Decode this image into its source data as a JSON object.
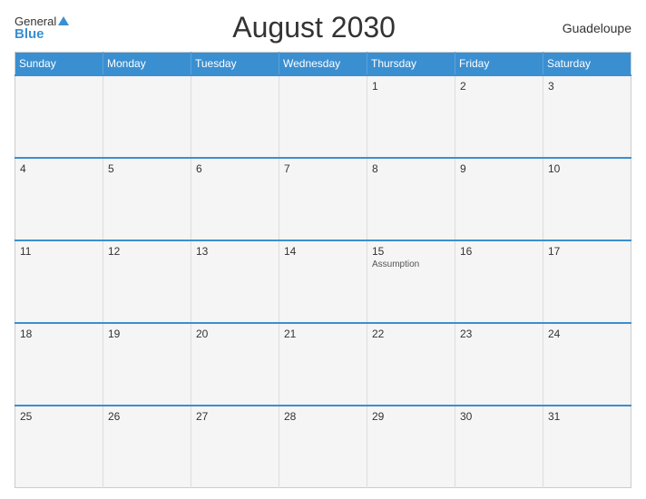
{
  "header": {
    "logo_line1": "General",
    "logo_line2": "Blue",
    "title": "August 2030",
    "country": "Guadeloupe"
  },
  "days_of_week": [
    "Sunday",
    "Monday",
    "Tuesday",
    "Wednesday",
    "Thursday",
    "Friday",
    "Saturday"
  ],
  "weeks": [
    [
      {
        "num": "",
        "holiday": ""
      },
      {
        "num": "",
        "holiday": ""
      },
      {
        "num": "",
        "holiday": ""
      },
      {
        "num": "",
        "holiday": ""
      },
      {
        "num": "1",
        "holiday": ""
      },
      {
        "num": "2",
        "holiday": ""
      },
      {
        "num": "3",
        "holiday": ""
      }
    ],
    [
      {
        "num": "4",
        "holiday": ""
      },
      {
        "num": "5",
        "holiday": ""
      },
      {
        "num": "6",
        "holiday": ""
      },
      {
        "num": "7",
        "holiday": ""
      },
      {
        "num": "8",
        "holiday": ""
      },
      {
        "num": "9",
        "holiday": ""
      },
      {
        "num": "10",
        "holiday": ""
      }
    ],
    [
      {
        "num": "11",
        "holiday": ""
      },
      {
        "num": "12",
        "holiday": ""
      },
      {
        "num": "13",
        "holiday": ""
      },
      {
        "num": "14",
        "holiday": ""
      },
      {
        "num": "15",
        "holiday": "Assumption"
      },
      {
        "num": "16",
        "holiday": ""
      },
      {
        "num": "17",
        "holiday": ""
      }
    ],
    [
      {
        "num": "18",
        "holiday": ""
      },
      {
        "num": "19",
        "holiday": ""
      },
      {
        "num": "20",
        "holiday": ""
      },
      {
        "num": "21",
        "holiday": ""
      },
      {
        "num": "22",
        "holiday": ""
      },
      {
        "num": "23",
        "holiday": ""
      },
      {
        "num": "24",
        "holiday": ""
      }
    ],
    [
      {
        "num": "25",
        "holiday": ""
      },
      {
        "num": "26",
        "holiday": ""
      },
      {
        "num": "27",
        "holiday": ""
      },
      {
        "num": "28",
        "holiday": ""
      },
      {
        "num": "29",
        "holiday": ""
      },
      {
        "num": "30",
        "holiday": ""
      },
      {
        "num": "31",
        "holiday": ""
      }
    ]
  ]
}
